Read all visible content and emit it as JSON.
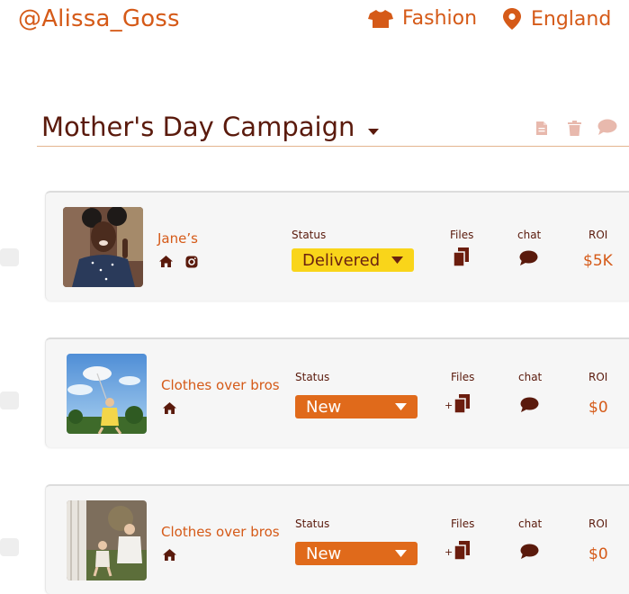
{
  "header": {
    "handle": "@Alissa_Goss",
    "category": "Fashion",
    "location": "England"
  },
  "campaign": {
    "title": "Mother's Day Campaign"
  },
  "columns": {
    "status": "Status",
    "files": "Files",
    "chat": "chat",
    "roi": "ROI"
  },
  "rows": [
    {
      "name": "Jane’s",
      "status": "Delivered",
      "roi": "$5K",
      "files_plus": ""
    },
    {
      "name": "Clothes over bros",
      "status": "New",
      "roi": "$0",
      "files_plus": "+"
    },
    {
      "name": "Clothes over bros",
      "status": "New",
      "roi": "$0",
      "files_plus": "+"
    }
  ],
  "colors": {
    "accent": "#d55a18",
    "dark": "#5a1a0c",
    "delivered": "#f9d51a",
    "new": "#e06a1b"
  }
}
